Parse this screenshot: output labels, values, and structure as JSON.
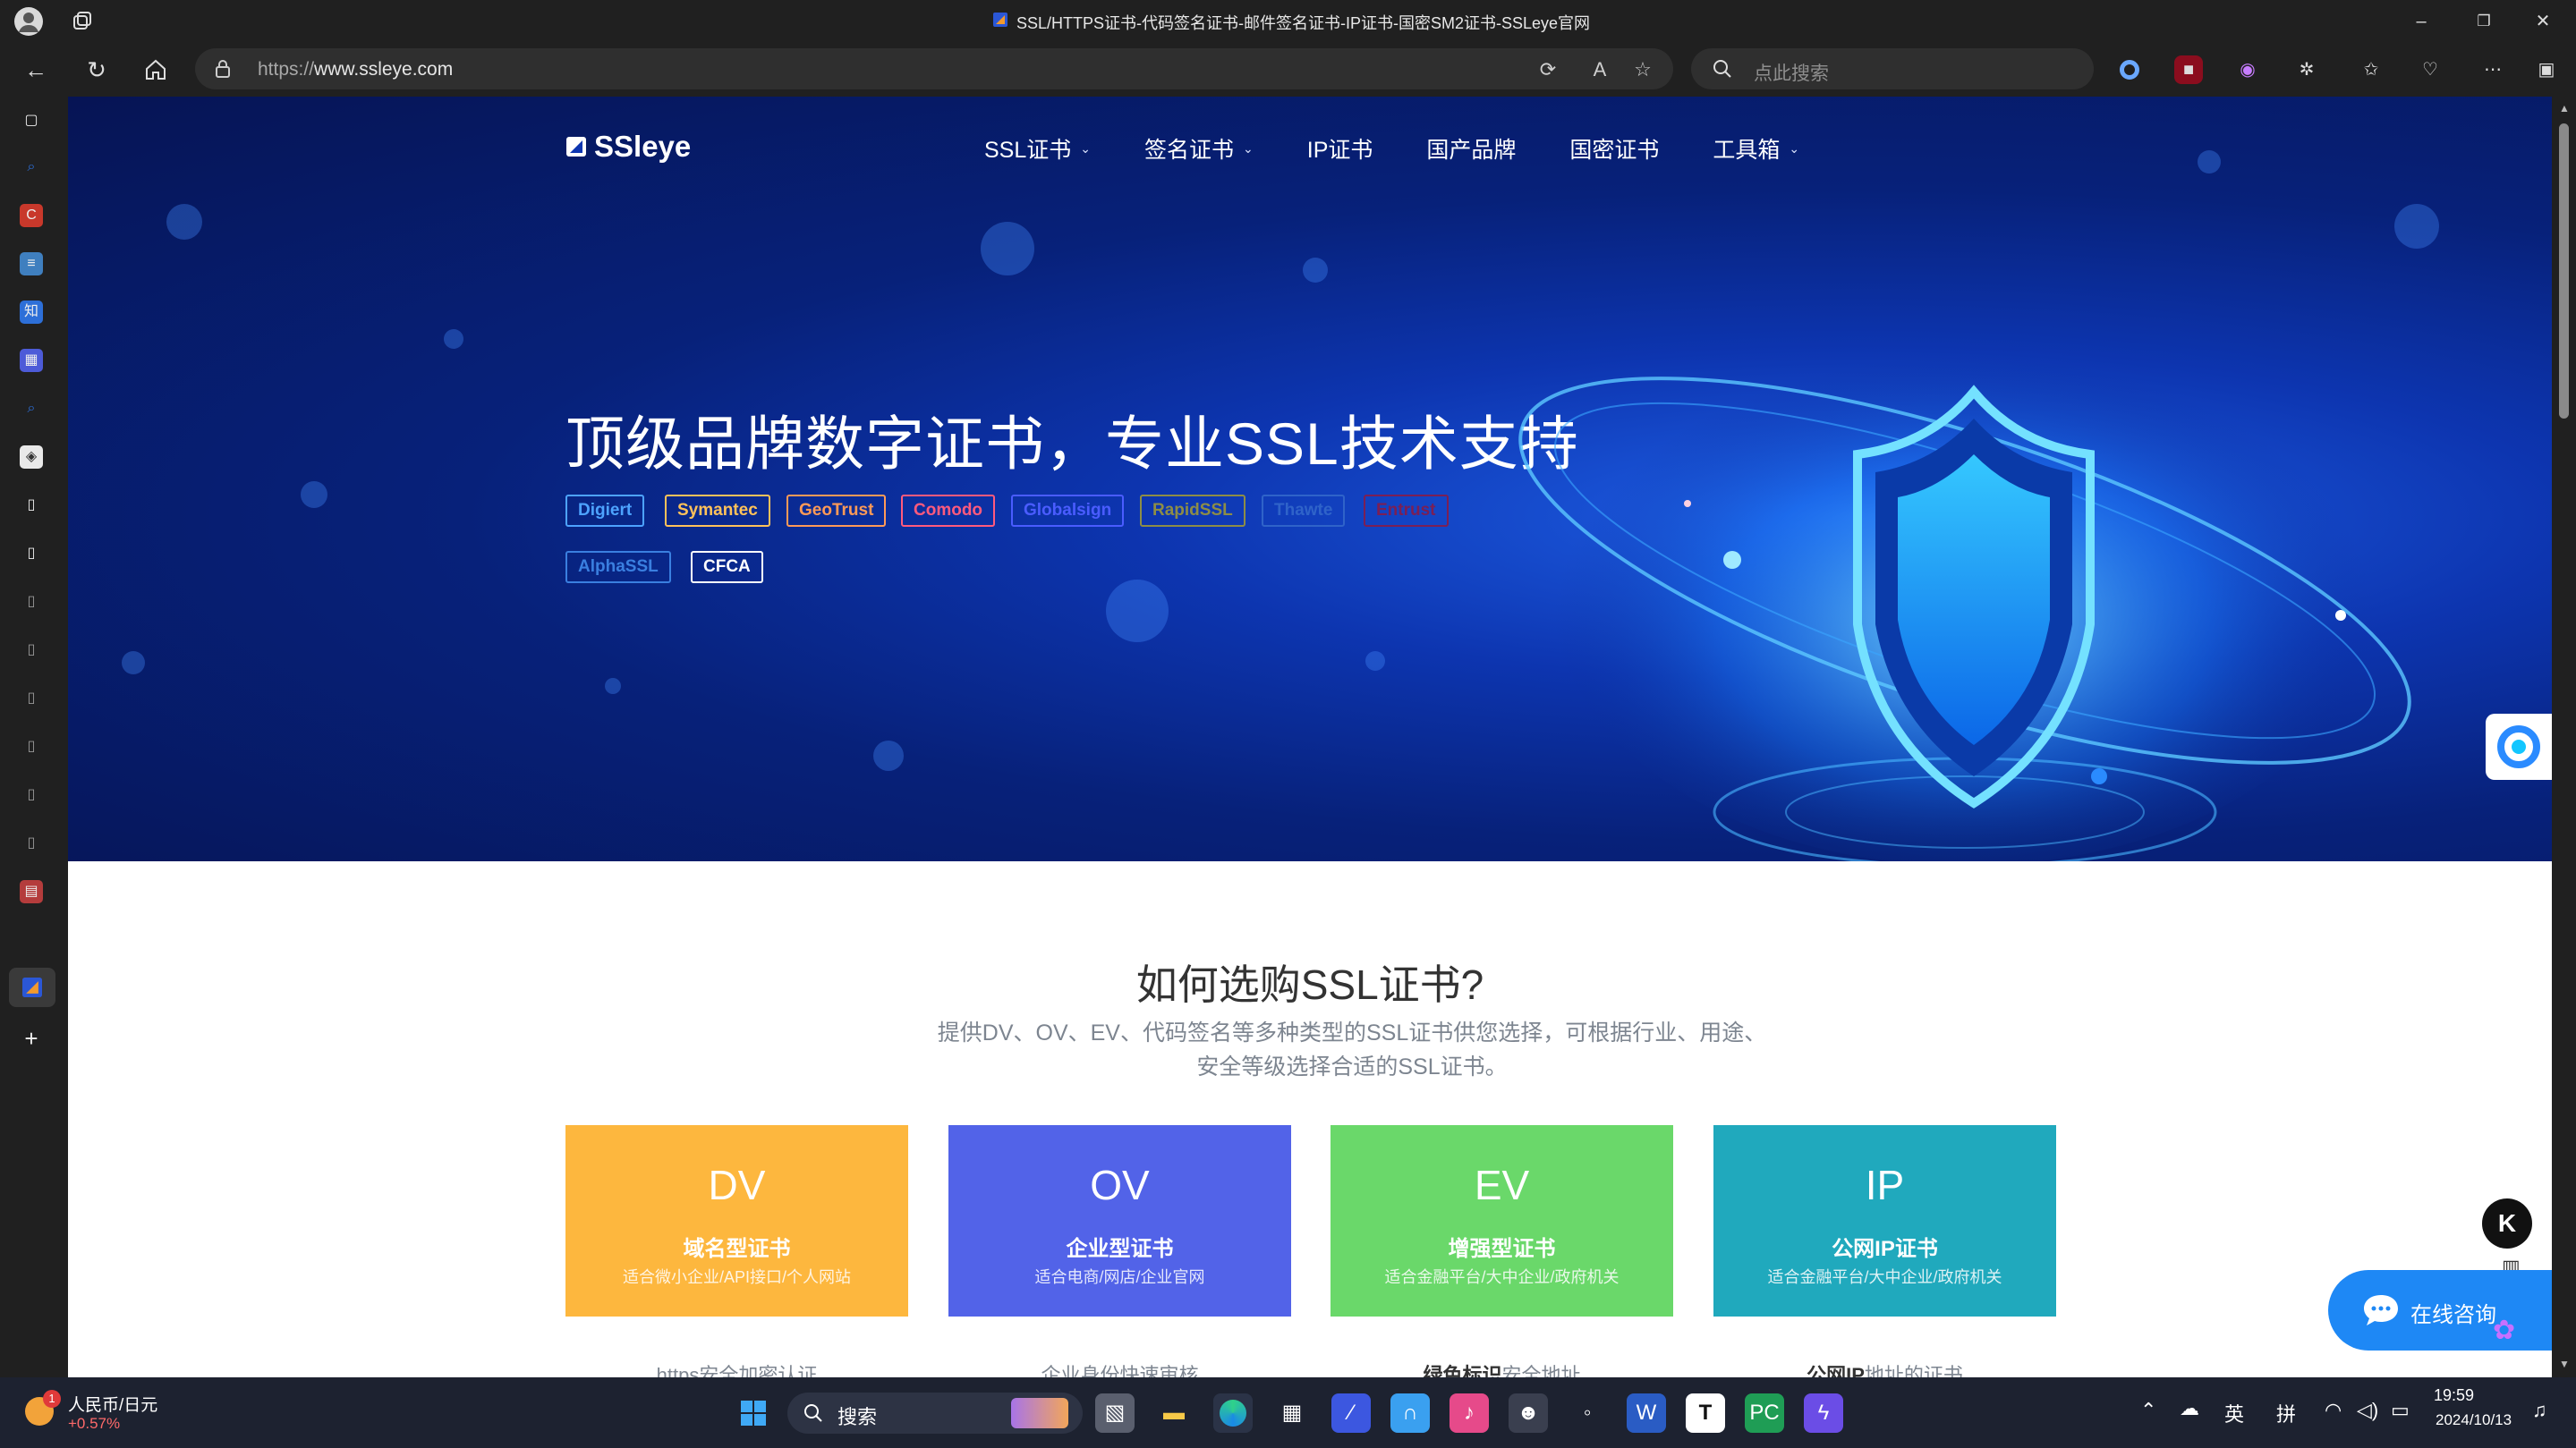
{
  "browser": {
    "tab_title": "SSL/HTTPS证书-代码签名证书-邮件签名证书-IP证书-国密SM2证书-SSLeye官网",
    "url_prefix": "https://",
    "url_domain": "www.ssleye.com",
    "search_placeholder": "点此搜索"
  },
  "site": {
    "logo_text": "SSleye",
    "nav": [
      {
        "label": "SSL证书",
        "has_dropdown": true
      },
      {
        "label": "签名证书",
        "has_dropdown": true
      },
      {
        "label": "IP证书",
        "has_dropdown": false
      },
      {
        "label": "国产品牌",
        "has_dropdown": false
      },
      {
        "label": "国密证书",
        "has_dropdown": false
      },
      {
        "label": "工具箱",
        "has_dropdown": true
      }
    ],
    "headline": "顶级品牌数字证书，专业SSL技术支持",
    "brands": [
      {
        "label": "Digiert",
        "color": "#4da3ff"
      },
      {
        "label": "Symantec",
        "color": "#ffc25a"
      },
      {
        "label": "GeoTrust",
        "color": "#ff9a57"
      },
      {
        "label": "Comodo",
        "color": "#ff5a7d"
      },
      {
        "label": "Globalsign",
        "color": "#4a5cff"
      },
      {
        "label": "RapidSSL",
        "color": "#8d8d46"
      },
      {
        "label": "Thawte",
        "color": "#2f63c9"
      },
      {
        "label": "Entrust",
        "color": "#7b1f55"
      },
      {
        "label": "AlphaSSL",
        "color": "#3a7fe0"
      },
      {
        "label": "CFCA",
        "color": "#ffffff"
      }
    ],
    "how_title": "如何选购SSL证书?",
    "how_desc_line1": "提供DV、OV、EV、代码签名等多种类型的SSL证书供您选择，可根据行业、用途、",
    "how_desc_line2": "安全等级选择合适的SSL证书。",
    "cards": [
      {
        "code": "DV",
        "name": "域名型证书",
        "sub": "适合微小企业/API接口/个人网站",
        "color": "#fdb73e",
        "below": "https安全加密认证"
      },
      {
        "code": "OV",
        "name": "企业型证书",
        "sub": "适合电商/网店/企业官网",
        "color": "#5263e8",
        "below": "企业身份快速审核"
      },
      {
        "code": "EV",
        "name": "增强型证书",
        "sub": "适合金融平台/大中企业/政府机关",
        "color": "#6ad86a",
        "below_strong": "绿色标识",
        "below": "安全地址"
      },
      {
        "code": "IP",
        "name": "公网IP证书",
        "sub": "适合金融平台/大中企业/政府机关",
        "color": "#20a9bd",
        "below_strong": "公网IP",
        "below": "地址的证书"
      }
    ],
    "chat_label": "在线咨询",
    "k_badge": "K"
  },
  "taskbar": {
    "ticker_title": "人民币/日元",
    "ticker_change": "+0.57%",
    "ticker_badge": "1",
    "search_label": "搜索",
    "ime_lang": "英",
    "ime_mode": "拼",
    "time": "19:59",
    "date": "2024/10/13"
  }
}
